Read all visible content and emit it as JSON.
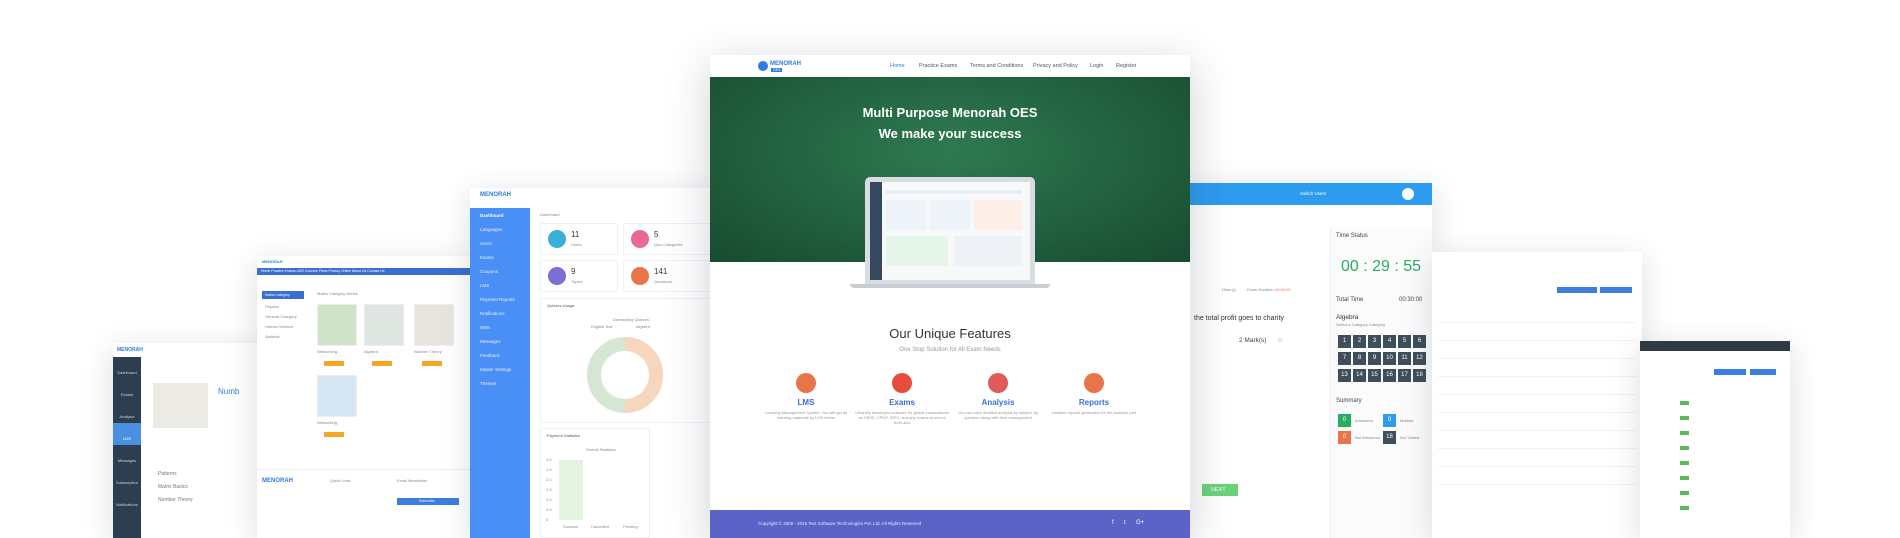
{
  "main": {
    "brand": "MENORAH",
    "brand_sub": "OES",
    "nav": [
      "Home",
      "Practice Exams",
      "Terms and Conditions",
      "Privacy and Policy",
      "Login",
      "Register"
    ],
    "hero_title_1": "Multi Purpose Menorah OES",
    "hero_title_2": "We make your success",
    "features_title": "Our Unique Features",
    "features_subtitle": "One Stop Solution for All Exam Needs",
    "features": [
      {
        "title": "LMS",
        "desc": "Learning Management System. You will get all learning materials by LMS below",
        "color": "#e8744a"
      },
      {
        "title": "Exams",
        "desc": "Uniquely developed software for global examinations as CBSE, CPMT, IBPS, and any exams at school level also",
        "color": "#e74c3c"
      },
      {
        "title": "Analysis",
        "desc": "You can have detailed analysis by subject, by question along with time management",
        "color": "#e05a5a"
      },
      {
        "title": "Reports",
        "desc": "Detailed reports generation for the analysis part",
        "color": "#e8744a"
      }
    ],
    "footer_copyright": "Copyright © 2009 - 2016 Text Software Technologies Pvt. Ltd. All Rights Reserved",
    "social": [
      "f",
      "t",
      "G+"
    ]
  },
  "exam": {
    "user_label": "Switch Users",
    "hints": "Hints (j)",
    "exam_duration_label": "Exam Duration:",
    "exam_duration": "00:30:00",
    "question_fragment": "the total profit goes to charity",
    "marks": "2 Mark(s)",
    "next": "NEXT",
    "time_status_label": "Time Status",
    "timer": "00 : 29 : 55",
    "total_time_label": "Total Time",
    "total_time": "00:30:00",
    "subject": "Algebra",
    "subject_sub": "Select a Category Category",
    "numbers": [
      "1",
      "2",
      "3",
      "4",
      "5",
      "6",
      "7",
      "8",
      "9",
      "10",
      "11",
      "12",
      "13",
      "14",
      "15",
      "16",
      "17",
      "18"
    ],
    "summary_label": "Summary",
    "summary": [
      {
        "count": "0",
        "label": "Answered",
        "color": "#27ae60"
      },
      {
        "count": "0",
        "label": "Marked",
        "color": "#2d9cf0"
      },
      {
        "count": "0",
        "label": "Not Answered",
        "color": "#e8744a"
      },
      {
        "count": "18",
        "label": "Not Visited",
        "color": "#3f4d5c"
      }
    ]
  },
  "admin": {
    "brand": "MENORAH",
    "sidebar": [
      "Dashboard",
      "Languages",
      "Users",
      "Exams",
      "Coupons",
      "LMS",
      "Payment Reports",
      "Notifications",
      "SMS",
      "Messages",
      "Feedback",
      "Master Settings",
      "Themes"
    ],
    "breadcrumb": "Dashboard",
    "tiles": [
      {
        "value": "11",
        "label": "Users",
        "color": "#3ab0d8"
      },
      {
        "value": "5",
        "label": "Quiz Categories",
        "color": "#e86a92"
      },
      {
        "value": "9",
        "label": "Topics",
        "color": "#7a6fd6"
      },
      {
        "value": "141",
        "label": "Questions",
        "color": "#e8744a"
      }
    ],
    "quizzes_usage": "Quizzes Usage",
    "demanding": "Demanding Quizzes",
    "legend": [
      "English Test",
      "Algebra"
    ],
    "payment_stats": "Payment Statistics",
    "overall_stats": "Overall Statistics",
    "payment_x": [
      "Success",
      "Cancelled",
      "Pending"
    ],
    "payment_y": [
      "3.0",
      "2.5",
      "2.0",
      "1.5",
      "1.0",
      "0.5",
      "0"
    ],
    "donut_colors": [
      "#f6d7bd",
      "#d6e6d4"
    ]
  },
  "green_card": {
    "brand": "MENORAH",
    "header_left": "Home  Practice Exams  LMS  Courses  Plans  Privacy  Online  About Us  Contact Us",
    "side_title": "Maths Category",
    "side_items": [
      "Physics",
      "General Category",
      "Human Science",
      "Aptitude"
    ],
    "content_title": "Maths Category Series",
    "cards": [
      "Networking",
      "Algebra",
      "Number Theory",
      "Networking"
    ],
    "footer_brand": "MENORAH",
    "footer_cols": [
      "Quick Links",
      "Email Newsletter"
    ],
    "subscribe": "Subscribe"
  },
  "left_card": {
    "brand": "MENORAH",
    "sidebar": [
      "Dashboard",
      "Exams",
      "Analysis",
      "LMS",
      "Messages",
      "Subscription",
      "Notifications"
    ],
    "heading": "Numb",
    "list": [
      "Patterns",
      "Matrix Basics",
      "Number Theory"
    ]
  }
}
